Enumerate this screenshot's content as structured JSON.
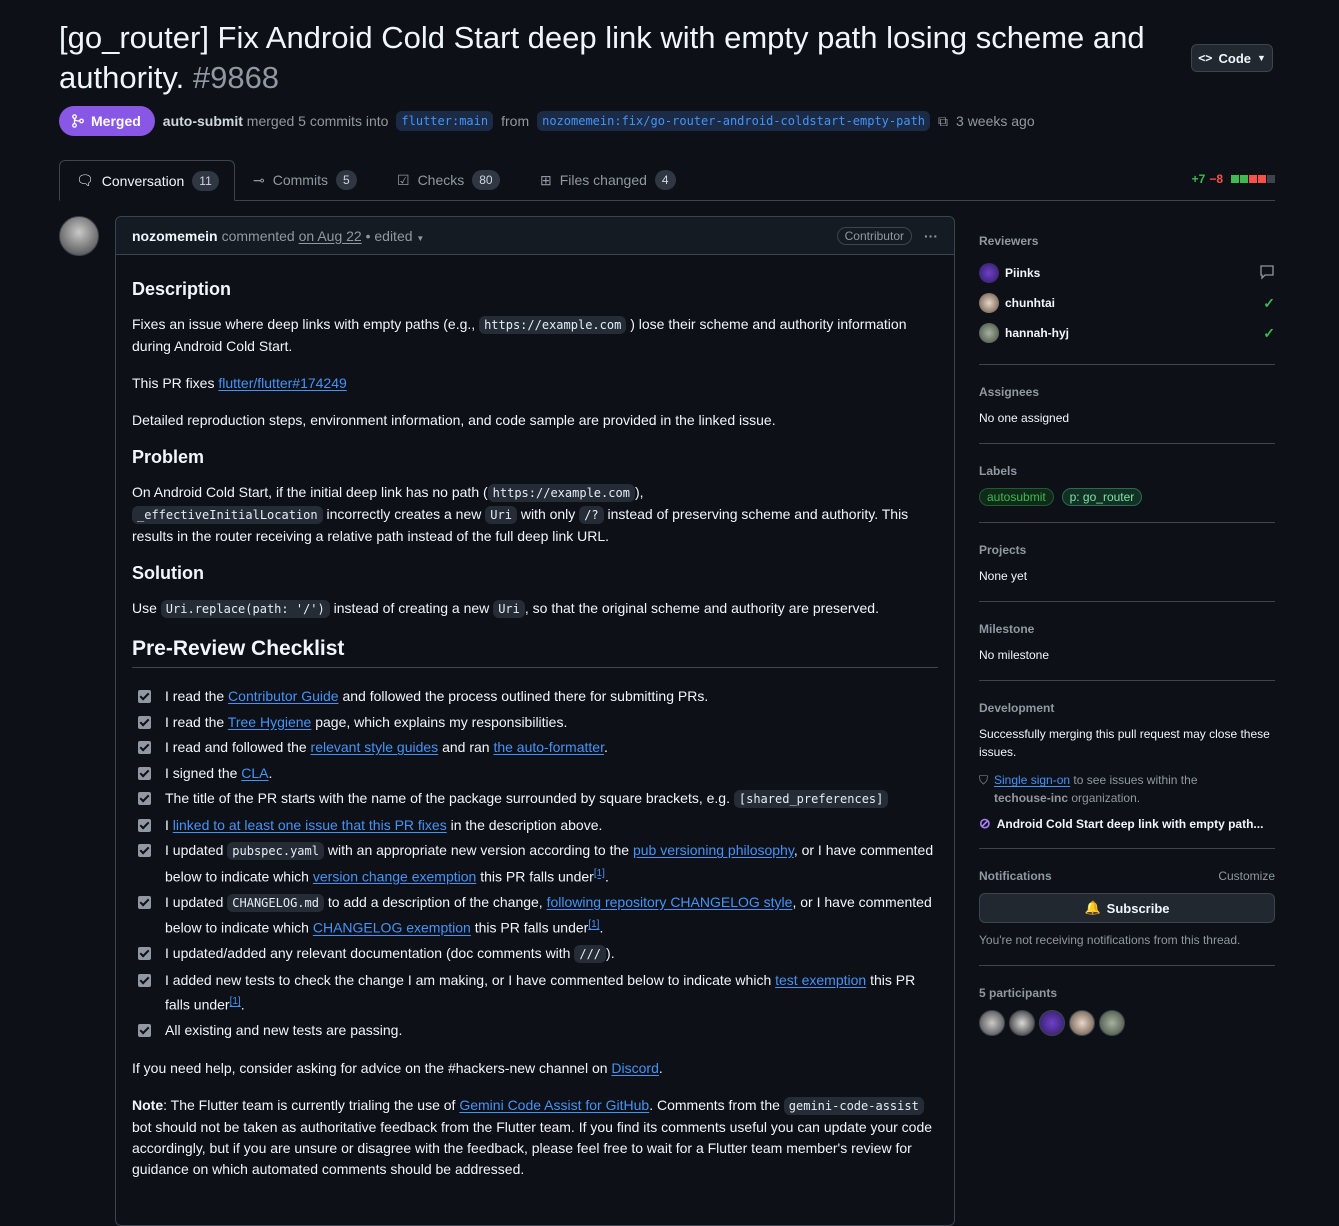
{
  "header": {
    "title": "[go_router] Fix Android Cold Start deep link with empty path losing scheme and authority.",
    "number": "#9868",
    "code_button": "Code",
    "state": "Merged",
    "merger": "auto-submit",
    "merge_text": "merged 5 commits into",
    "base_branch": "flutter:main",
    "from_text": "from",
    "head_branch": "nozomemein:fix/go-router-android-coldstart-empty-path",
    "time": "3 weeks ago"
  },
  "tabs": [
    {
      "label": "Conversation",
      "count": "11"
    },
    {
      "label": "Commits",
      "count": "5"
    },
    {
      "label": "Checks",
      "count": "80"
    },
    {
      "label": "Files changed",
      "count": "4"
    }
  ],
  "diffstat": {
    "additions": "+7",
    "deletions": "−8"
  },
  "comment": {
    "author": "nozomemein",
    "action": "commented",
    "date": "on Aug 22",
    "edited": "• edited",
    "role": "Contributor",
    "more": "···"
  },
  "body": {
    "h_description": "Description",
    "desc_p1_a": "Fixes an issue where deep links with empty paths (e.g.,",
    "desc_p1_code": "https://example.com",
    "desc_p1_b": ") lose their scheme and authority information during Android Cold Start.",
    "desc_p2_a": "This PR fixes",
    "desc_p2_link": "flutter/flutter#174249",
    "desc_p3": "Detailed reproduction steps, environment information, and code sample are provided in the linked issue.",
    "h_problem": "Problem",
    "prob_a": "On Android Cold Start, if the initial deep link has no path (",
    "prob_code1": "https://example.com",
    "prob_b": "),",
    "prob_code2": "_effectiveInitialLocation",
    "prob_c": "incorrectly creates a new",
    "prob_code3": "Uri",
    "prob_d": "with only",
    "prob_code4": "/?",
    "prob_e": "instead of preserving scheme and authority. This results in the router receiving a relative path instead of the full deep link URL.",
    "h_solution": "Solution",
    "sol_a": "Use",
    "sol_code1": "Uri.replace(path: '/')",
    "sol_b": "instead of creating a new",
    "sol_code2": "Uri",
    "sol_c": ", so that the original scheme and authority are preserved.",
    "h_checklist": "Pre-Review Checklist",
    "c1_a": "I read the",
    "c1_link": "Contributor Guide",
    "c1_b": "and followed the process outlined there for submitting PRs.",
    "c2_a": "I read the",
    "c2_link": "Tree Hygiene",
    "c2_b": "page, which explains my responsibilities.",
    "c3_a": "I read and followed the",
    "c3_link1": "relevant style guides",
    "c3_b": "and ran",
    "c3_link2": "the auto-formatter",
    "c3_c": ".",
    "c4_a": "I signed the",
    "c4_link": "CLA",
    "c4_b": ".",
    "c5_a": "The title of the PR starts with the name of the package surrounded by square brackets, e.g.",
    "c5_code": "[shared_preferences]",
    "c6_a": "I",
    "c6_link": "linked to at least one issue that this PR fixes",
    "c6_b": "in the description above.",
    "c7_a": "I updated",
    "c7_code": "pubspec.yaml",
    "c7_b": "with an appropriate new version according to the",
    "c7_link1": "pub versioning philosophy",
    "c7_c": ", or I have commented below to indicate which",
    "c7_link2": "version change exemption",
    "c7_d": "this PR falls under",
    "c7_sup": "[1]",
    "c7_e": ".",
    "c8_a": "I updated",
    "c8_code": "CHANGELOG.md",
    "c8_b": "to add a description of the change,",
    "c8_link1": "following repository CHANGELOG style",
    "c8_c": ", or I have commented below to indicate which",
    "c8_link2": "CHANGELOG exemption",
    "c8_d": "this PR falls under",
    "c8_sup": "[1]",
    "c8_e": ".",
    "c9_a": "I updated/added any relevant documentation (doc comments with",
    "c9_code": "///",
    "c9_b": ").",
    "c10_a": "I added new tests to check the change I am making, or I have commented below to indicate which",
    "c10_link": "test exemption",
    "c10_b": "this PR falls under",
    "c10_sup": "[1]",
    "c10_c": ".",
    "c11": "All existing and new tests are passing.",
    "help_a": "If you need help, consider asking for advice on the #hackers-new channel on",
    "help_link": "Discord",
    "help_b": ".",
    "note_label": "Note",
    "note_a": ": The Flutter team is currently trialing the use of",
    "note_link": "Gemini Code Assist for GitHub",
    "note_b": ". Comments from the",
    "note_code": "gemini-code-assist",
    "note_c": "bot should not be taken as authoritative feedback from the Flutter team. If you find its comments useful you can update your code accordingly, but if you are unsure or disagree with the feedback, please feel free to wait for a Flutter team member's review for guidance on which automated comments should be addressed."
  },
  "sidebar": {
    "reviewers_title": "Reviewers",
    "reviewers": [
      {
        "name": "Piinks",
        "status": "comment-icon"
      },
      {
        "name": "chunhtai",
        "status": "check-icon"
      },
      {
        "name": "hannah-hyj",
        "status": "check-icon"
      }
    ],
    "assignees_title": "Assignees",
    "assignees_text": "No one assigned",
    "labels_title": "Labels",
    "labels": [
      {
        "name": "autosubmit",
        "color": "#3fb950"
      },
      {
        "name": "p: go_router",
        "color": "#56d364"
      }
    ],
    "projects_title": "Projects",
    "projects_text": "None yet",
    "milestone_title": "Milestone",
    "milestone_text": "No milestone",
    "development_title": "Development",
    "development_text": "Successfully merging this pull request may close these issues.",
    "sso_link": "Single sign-on",
    "sso_a": "to see issues within the",
    "sso_org": "techouse-inc",
    "sso_b": "organization.",
    "dev_issue": "Android Cold Start deep link with empty path...",
    "notifications_title": "Notifications",
    "customize": "Customize",
    "subscribe": "Subscribe",
    "notif_text": "You're not receiving notifications from this thread.",
    "participants_title": "5 participants"
  },
  "colors": {
    "merged": "#8957e5",
    "link": "#4493f8",
    "add": "#3fb950",
    "del": "#f85149"
  }
}
